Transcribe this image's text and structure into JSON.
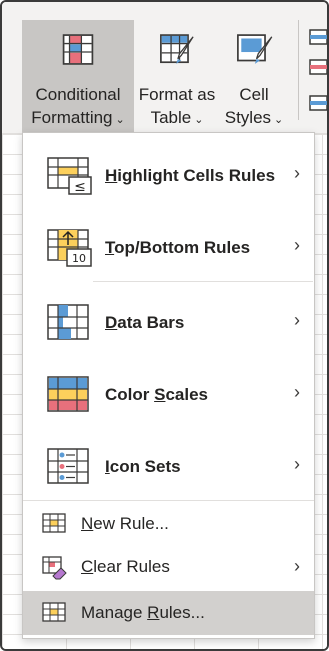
{
  "ribbon": {
    "buttons": [
      {
        "line1": "Conditional",
        "line2": "Formatting",
        "icon": "conditional-formatting-icon",
        "active": true
      },
      {
        "line1": "Format as",
        "line2": "Table",
        "icon": "format-as-table-icon",
        "active": false
      },
      {
        "line1": "Cell",
        "line2": "Styles",
        "icon": "cell-styles-icon",
        "active": false
      }
    ]
  },
  "menu": {
    "items": [
      {
        "pre": "",
        "key": "H",
        "post": "ighlight Cells Rules",
        "icon": "highlight-cells-rules-icon",
        "submenu": true
      },
      {
        "pre": "",
        "key": "T",
        "post": "op/Bottom Rules",
        "icon": "top-bottom-rules-icon",
        "submenu": true
      },
      {
        "pre": "",
        "key": "D",
        "post": "ata Bars",
        "icon": "data-bars-icon",
        "submenu": true
      },
      {
        "pre": "Color ",
        "key": "S",
        "post": "cales",
        "icon": "color-scales-icon",
        "submenu": true
      },
      {
        "pre": "",
        "key": "I",
        "post": "con Sets",
        "icon": "icon-sets-icon",
        "submenu": true
      },
      {
        "pre": "",
        "key": "N",
        "post": "ew Rule...",
        "icon": "new-rule-icon",
        "submenu": false
      },
      {
        "pre": "",
        "key": "C",
        "post": "lear Rules",
        "icon": "clear-rules-icon",
        "submenu": true
      },
      {
        "pre": "Manage ",
        "key": "R",
        "post": "ules...",
        "icon": "manage-rules-icon",
        "submenu": false,
        "highlighted": true
      }
    ],
    "submenu_glyph": "›",
    "chevron_glyph": "⌄"
  },
  "colors": {
    "ribbon_bg": "#f3f2f1",
    "active_button": "#c8c6c4",
    "hover_item": "#d2d0ce",
    "accent_red": "#e8707c",
    "accent_blue": "#5b9bd5",
    "accent_yellow": "#fcd05c"
  }
}
